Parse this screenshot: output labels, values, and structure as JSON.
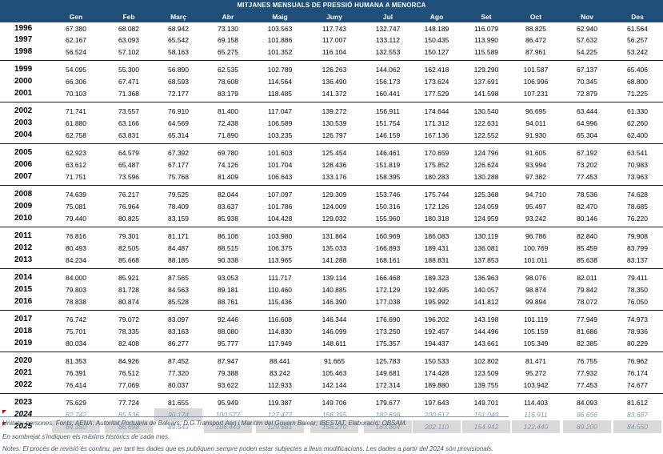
{
  "title": "MITJANES MENSUALS DE PRESSIÓ HUMANA A MENORCA",
  "months": [
    "Gen",
    "Feb",
    "Març",
    "Abr",
    "Maig",
    "Juny",
    "Jul",
    "Ago",
    "Set",
    "Oct",
    "Nov",
    "Des"
  ],
  "rows": [
    {
      "year": "1996",
      "values": [
        "67.380",
        "68.082",
        "68.942",
        "73.130",
        "103.563",
        "117.743",
        "132.747",
        "148.189",
        "116.079",
        "88.825",
        "62.940",
        "61.564"
      ]
    },
    {
      "year": "1997",
      "values": [
        "62.167",
        "63.093",
        "65.542",
        "69.158",
        "101.886",
        "117.007",
        "133.112",
        "150.435",
        "113.990",
        "86.472",
        "57.632",
        "56.257"
      ]
    },
    {
      "year": "1998",
      "values": [
        "56.524",
        "57.102",
        "58.163",
        "65.275",
        "101.352",
        "116.104",
        "132.553",
        "150.127",
        "115.589",
        "87.961",
        "54.225",
        "53.242"
      ]
    },
    {
      "year": "1999",
      "values": [
        "54.095",
        "55.300",
        "56.890",
        "62.535",
        "102.789",
        "126.263",
        "144.062",
        "162.418",
        "129.290",
        "101.587",
        "67.137",
        "65.406"
      ]
    },
    {
      "year": "2000",
      "values": [
        "66.306",
        "67.471",
        "68.593",
        "78.608",
        "114.564",
        "136.490",
        "156.173",
        "173.624",
        "137.691",
        "106.996",
        "70.345",
        "68.800"
      ]
    },
    {
      "year": "2001",
      "values": [
        "70.103",
        "71.368",
        "72.177",
        "83.179",
        "118.485",
        "141.372",
        "160.441",
        "177.529",
        "141.598",
        "107.231",
        "72.879",
        "71.225"
      ]
    },
    {
      "year": "2002",
      "values": [
        "71.741",
        "73.557",
        "76.910",
        "81.400",
        "117.047",
        "139.272",
        "156.911",
        "174.644",
        "130.540",
        "96.695",
        "63.444",
        "61.330"
      ]
    },
    {
      "year": "2003",
      "values": [
        "61.880",
        "63.166",
        "64.569",
        "72.438",
        "106.589",
        "130.539",
        "151.754",
        "171.312",
        "122.631",
        "94.011",
        "64.996",
        "62.260"
      ]
    },
    {
      "year": "2004",
      "values": [
        "62.758",
        "63.831",
        "65.314",
        "71.890",
        "103.235",
        "126.797",
        "146.159",
        "167.136",
        "122.552",
        "91.930",
        "65.304",
        "62.400"
      ]
    },
    {
      "year": "2005",
      "values": [
        "62.923",
        "64.579",
        "67.392",
        "69.780",
        "101.603",
        "125.454",
        "146.461",
        "170.659",
        "124.796",
        "91.605",
        "67.192",
        "63.541"
      ]
    },
    {
      "year": "2006",
      "values": [
        "63.612",
        "65.487",
        "67.177",
        "74.126",
        "101.704",
        "128.436",
        "151.819",
        "175.852",
        "126.624",
        "93.994",
        "73.202",
        "70.983"
      ]
    },
    {
      "year": "2007",
      "values": [
        "71.751",
        "73.596",
        "75.768",
        "81.409",
        "106.643",
        "133.176",
        "158.395",
        "180.283",
        "130.288",
        "97.382",
        "77.453",
        "73.963"
      ]
    },
    {
      "year": "2008",
      "values": [
        "74.639",
        "76.217",
        "79.525",
        "82.044",
        "107.097",
        "129.309",
        "153.746",
        "175.744",
        "125.368",
        "94.710",
        "78.536",
        "74.628"
      ]
    },
    {
      "year": "2009",
      "values": [
        "75.081",
        "76.964",
        "78.409",
        "83.637",
        "101.786",
        "124.009",
        "150.316",
        "172.126",
        "124.059",
        "95.497",
        "82.470",
        "78.685"
      ]
    },
    {
      "year": "2010",
      "values": [
        "79.440",
        "80.825",
        "83.159",
        "85.938",
        "104.428",
        "129.032",
        "155.960",
        "180.318",
        "124.959",
        "93.242",
        "80.146",
        "76.220"
      ]
    },
    {
      "year": "2011",
      "values": [
        "76.816",
        "79.301",
        "81.171",
        "86.106",
        "103.980",
        "131.864",
        "160.969",
        "186.083",
        "130.119",
        "96.786",
        "82.840",
        "79.908"
      ]
    },
    {
      "year": "2012",
      "values": [
        "80.493",
        "82.505",
        "84.487",
        "88.515",
        "106.375",
        "135.033",
        "166.893",
        "189.431",
        "136.081",
        "100.769",
        "85.459",
        "83.799"
      ]
    },
    {
      "year": "2013",
      "values": [
        "84.234",
        "85.668",
        "88.185",
        "90.338",
        "113.965",
        "141.288",
        "168.161",
        "188.831",
        "137.853",
        "101.011",
        "85.638",
        "83.137"
      ]
    },
    {
      "year": "2014",
      "values": [
        "84.000",
        "85.921",
        "87.565",
        "93.053",
        "111.717",
        "139.114",
        "166.468",
        "189.323",
        "136.963",
        "98.076",
        "82.011",
        "79.411"
      ]
    },
    {
      "year": "2015",
      "values": [
        "79.803",
        "81.728",
        "84.563",
        "89.181",
        "110.460",
        "140.885",
        "172.129",
        "192.495",
        "140.057",
        "98.874",
        "79.842",
        "78.350"
      ]
    },
    {
      "year": "2016",
      "values": [
        "78.838",
        "80.874",
        "85.528",
        "88.761",
        "115.436",
        "146.390",
        "177.038",
        "195.992",
        "141.812",
        "99.894",
        "78.072",
        "76.050"
      ]
    },
    {
      "year": "2017",
      "values": [
        "76.742",
        "79.072",
        "83.097",
        "92.446",
        "116.608",
        "146.344",
        "176.690",
        "196.202",
        "143.198",
        "101.119",
        "77.949",
        "74.973"
      ]
    },
    {
      "year": "2018",
      "values": [
        "75.701",
        "78.335",
        "83.163",
        "88.080",
        "114.830",
        "146.099",
        "173.250",
        "192.457",
        "144.496",
        "105.159",
        "81.686",
        "78.936"
      ]
    },
    {
      "year": "2019",
      "values": [
        "80.034",
        "82.408",
        "86.277",
        "95.777",
        "117.949",
        "148.611",
        "175.357",
        "194.437",
        "143.661",
        "105.349",
        "82.385",
        "80.229"
      ]
    },
    {
      "year": "2020",
      "values": [
        "81.353",
        "84.926",
        "87.452",
        "87.947",
        "88.441",
        "91.665",
        "125.783",
        "150.533",
        "102.802",
        "81.471",
        "76.755",
        "76.962"
      ]
    },
    {
      "year": "2021",
      "values": [
        "76.391",
        "76.512",
        "77.320",
        "79.388",
        "83.242",
        "105.463",
        "149.681",
        "174.428",
        "123.509",
        "95.272",
        "77.932",
        "76.174"
      ]
    },
    {
      "year": "2022",
      "values": [
        "76.414",
        "77.069",
        "80.037",
        "93.622",
        "112.933",
        "142.144",
        "172.314",
        "189.880",
        "139.755",
        "103.942",
        "77.453",
        "74.677"
      ]
    },
    {
      "year": "2023",
      "values": [
        "75.629",
        "77.724",
        "81.655",
        "95.949",
        "119.387",
        "149.706",
        "179.677",
        "197.643",
        "149.701",
        "114.403",
        "84.093",
        "81.612"
      ]
    },
    {
      "year": "2024",
      "values": [
        "82.742",
        "85.536",
        "90.174",
        "100.577",
        "127.477",
        "156.395",
        "182.698",
        "200.617",
        "151.049",
        "116.911",
        "86.656",
        "83.687"
      ]
    },
    {
      "year": "2025",
      "values": [
        "84.350",
        "86.698",
        "89.543",
        "106.443",
        "129.681",
        "158.270",
        "183.804",
        "202.110",
        "154.942",
        "122.440",
        "89.200",
        "84.550"
      ]
    }
  ],
  "notes": {
    "units": "Unitats: persones. Fonts: AENA; Autoritat Portuària de Balears; D.G.Transport Aeri i Marítim del Govern Balear; IBESTAT. Elaboració: OBSAM.",
    "shading": "En sombrejat s'indiquen els màxims històrics de cada mes.",
    "revision": "Notes: El procés de revisió és continu, per tant les dades que es publiquen sempre poden estar subjectes a lleus modificacions. Les dades a partir del 2024 són provisionals."
  },
  "colors": {
    "header_bg": "#1f4e79",
    "header_text": "#ffffff",
    "max_shade": "#d9d9d9",
    "provisional_text": "#8497b0",
    "flag": "#c00000"
  }
}
